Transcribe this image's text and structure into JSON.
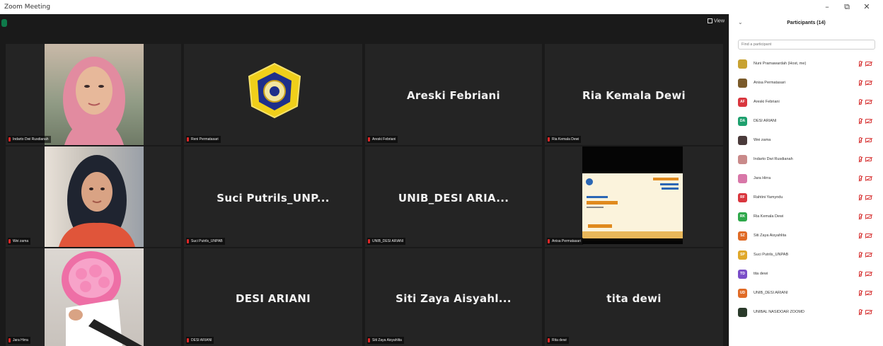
{
  "window": {
    "title": "Zoom Meeting",
    "minimize": "–",
    "restore": "⧉",
    "close": "✕"
  },
  "toolbar": {
    "view_label": "View"
  },
  "tiles": [
    {
      "caption": "Indarto Dwi Rusdianah",
      "big_name": ""
    },
    {
      "caption": "Reni Permatasari",
      "big_name": ""
    },
    {
      "caption": "Areski Febriani",
      "big_name": "Areski Febriani"
    },
    {
      "caption": "Ria Kemala Dewi",
      "big_name": "Ria Kemala Dewi"
    },
    {
      "caption": "Wei zama",
      "big_name": ""
    },
    {
      "caption": "Suci Putrils_UNPAB",
      "big_name": "Suci Putrils_UNP..."
    },
    {
      "caption": "UNIB_DESI ARIANI",
      "big_name": "UNIB_DESI ARIA..."
    },
    {
      "caption": "Anisa Permatasari",
      "big_name": ""
    },
    {
      "caption": "Jara Hirra",
      "big_name": ""
    },
    {
      "caption": "DESI ARIANI",
      "big_name": "DESI ARIANI"
    },
    {
      "caption": "Siti Zaya Aisyahlita",
      "big_name": "Siti Zaya Aisyahl..."
    },
    {
      "caption": "Rita dewi",
      "big_name": "tita dewi"
    }
  ],
  "panel": {
    "back": "⌄",
    "title": "Participants (14)",
    "search_placeholder": "Find a participant",
    "participants": [
      {
        "initials": "",
        "name": "Nuni Pramawardah (Host, me)",
        "color": "#c8a232"
      },
      {
        "initials": "",
        "name": "Anisa Permatasari",
        "color": "#7a5a2a"
      },
      {
        "initials": "AF",
        "name": "Areski Febriani",
        "color": "#d9363e"
      },
      {
        "initials": "DA",
        "name": "DESI ARIANI",
        "color": "#1ea06e"
      },
      {
        "initials": "",
        "name": "Wei zama",
        "color": "#4a3a3a"
      },
      {
        "initials": "",
        "name": "Indarto Dwi Rusdianah",
        "color": "#c98a8a"
      },
      {
        "initials": "",
        "name": "Jara Hirra",
        "color": "#d877a8"
      },
      {
        "initials": "RF",
        "name": "Rahtini Yamyndu",
        "color": "#d9363e"
      },
      {
        "initials": "RK",
        "name": "Ria Kemala Dewi",
        "color": "#2ea84a"
      },
      {
        "initials": "SZ",
        "name": "Siti Zaya Aisyahlita",
        "color": "#e06b26"
      },
      {
        "initials": "SP",
        "name": "Suci Putrils_UNPAB",
        "color": "#e0a82a"
      },
      {
        "initials": "TD",
        "name": "tita dewi",
        "color": "#7a4ec8"
      },
      {
        "initials": "UD",
        "name": "UNIB_DESI ARIANI",
        "color": "#e06b26"
      },
      {
        "initials": "",
        "name": "UNIBAL NASIDOAR ZOOMD",
        "color": "#2a3a2a"
      }
    ]
  },
  "colors": {
    "meeting_bg": "#1a1a1a",
    "tile_bg": "#242424",
    "accent_red": "#d83a3a"
  }
}
